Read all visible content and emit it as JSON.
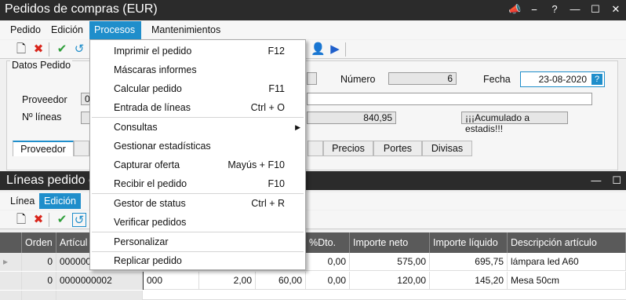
{
  "window": {
    "title": "Pedidos de compras (EUR)"
  },
  "menus": [
    "Pedido",
    "Edición",
    "Procesos",
    "Mantenimientos"
  ],
  "datos_pedido": {
    "legend": "Datos Pedido",
    "proveedor_label": "Proveedor",
    "proveedor_value": "00",
    "lineas_label": "Nº líneas",
    "numero_label": "Número",
    "numero_value": "6",
    "fecha_label": "Fecha",
    "fecha_value": "23-08-2020",
    "fecha_btn": "?",
    "importe_value": "840,95",
    "acumulado_label": "¡¡¡Acumulado a estadis!!!"
  },
  "tabs": [
    "Proveedor",
    "Precios",
    "Portes",
    "Divisas"
  ],
  "lineas": {
    "title": "Líneas pedido c",
    "menus": [
      "Línea",
      "Edición"
    ]
  },
  "grid": {
    "headers": [
      "Orden",
      "Artícul",
      "%Dto.",
      "Importe neto",
      "Importe líquido",
      "Descripción artículo"
    ],
    "rows": [
      {
        "orden": "0",
        "articulo": "000000",
        "col3": "",
        "col4": "",
        "col5": "",
        "dto": "0,00",
        "neto": "575,00",
        "liquido": "695,75",
        "desc": "lámpara led A60"
      },
      {
        "orden": "0",
        "articulo": "0000000002",
        "col3": "000",
        "col4": "2,00",
        "col5": "60,00",
        "dto": "0,00",
        "neto": "120,00",
        "liquido": "145,20",
        "desc": "Mesa 50cm"
      }
    ]
  },
  "dropdown": {
    "items": [
      {
        "label": "Imprimir el pedido",
        "shortcut": "F12"
      },
      {
        "label": "Máscaras informes",
        "shortcut": ""
      },
      {
        "label": "Calcular pedido",
        "shortcut": "F11"
      },
      {
        "label": "Entrada de líneas",
        "shortcut": "Ctrl + O"
      },
      {
        "label": "Consultas",
        "shortcut": ""
      },
      {
        "label": "Gestionar estadísticas",
        "shortcut": ""
      },
      {
        "label": "Capturar oferta",
        "shortcut": "Mayús + F10"
      },
      {
        "label": "Recibir el pedido",
        "shortcut": "F10"
      },
      {
        "label": "Gestor de status",
        "shortcut": "Ctrl + R"
      },
      {
        "label": "Verificar pedidos",
        "shortcut": ""
      },
      {
        "label": "Personalizar",
        "shortcut": ""
      },
      {
        "label": "Replicar pedido",
        "shortcut": ""
      }
    ]
  },
  "icons": [
    "pin-icon",
    "help-icon",
    "minimize-icon",
    "maximize-icon",
    "close-icon",
    "new-icon",
    "delete-icon",
    "accept-icon",
    "undo-icon",
    "user-icon",
    "navigate-icon"
  ],
  "colors": {
    "accent": "#1f8ecb",
    "titlebar": "#2b2b2b",
    "grid_header": "#5a5a5a"
  }
}
